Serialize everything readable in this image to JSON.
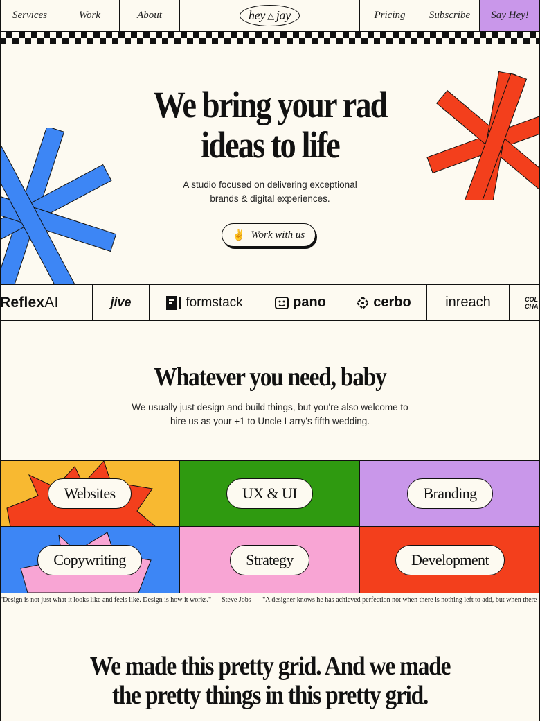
{
  "nav": {
    "left": [
      "Services",
      "Work",
      "About"
    ],
    "logo": {
      "word1": "hey",
      "mark": "△",
      "word2": "jay"
    },
    "right": [
      "Pricing",
      "Subscribe"
    ],
    "cta": "Say Hey!"
  },
  "hero": {
    "title_lines": [
      "We bring your rad",
      "ideas to life"
    ],
    "subtitle_lines": [
      "A studio focused on delivering exceptional",
      "brands & digital experiences."
    ],
    "button": {
      "emoji": "✌",
      "label": "Work with us"
    }
  },
  "clients": {
    "reflex": {
      "main": "Reflex",
      "suffix": "AI"
    },
    "jive": "jive",
    "formstack": "formstack",
    "pano": "pano",
    "cerbo": "cerbo",
    "inreach": "inreach",
    "partial_lines": [
      "COL",
      "CHA"
    ]
  },
  "services": {
    "title": "Whatever you need, baby",
    "subtitle_lines": [
      "We usually just design and build things, but you're also welcome to",
      "hire us as your +1 to Uncle Larry's fifth wedding."
    ],
    "tiles": [
      {
        "label": "Websites",
        "color": "#f8b931"
      },
      {
        "label": "UX & UI",
        "color": "#2f9a10"
      },
      {
        "label": "Branding",
        "color": "#c997ea"
      },
      {
        "label": "Copywriting",
        "color": "#3d86f5"
      },
      {
        "label": "Strategy",
        "color": "#f8a5d4"
      },
      {
        "label": "Development",
        "color": "#f33f1c"
      }
    ]
  },
  "quotes": [
    "\"Design is not just what it looks like and feels like. Design is how it works.\" — Steve Jobs",
    "\"A designer knows he has achieved perfection not when there is nothing left to add, but when there is nothing left to take away.\" —"
  ],
  "bottom": {
    "title_lines": [
      "We made this pretty grid. And we made",
      "the pretty things in this pretty grid."
    ]
  },
  "colors": {
    "background": "#fdfaf1",
    "star_red": "#f33f1c",
    "star_blue": "#3d86f5",
    "nav_cta": "#c997ea"
  }
}
